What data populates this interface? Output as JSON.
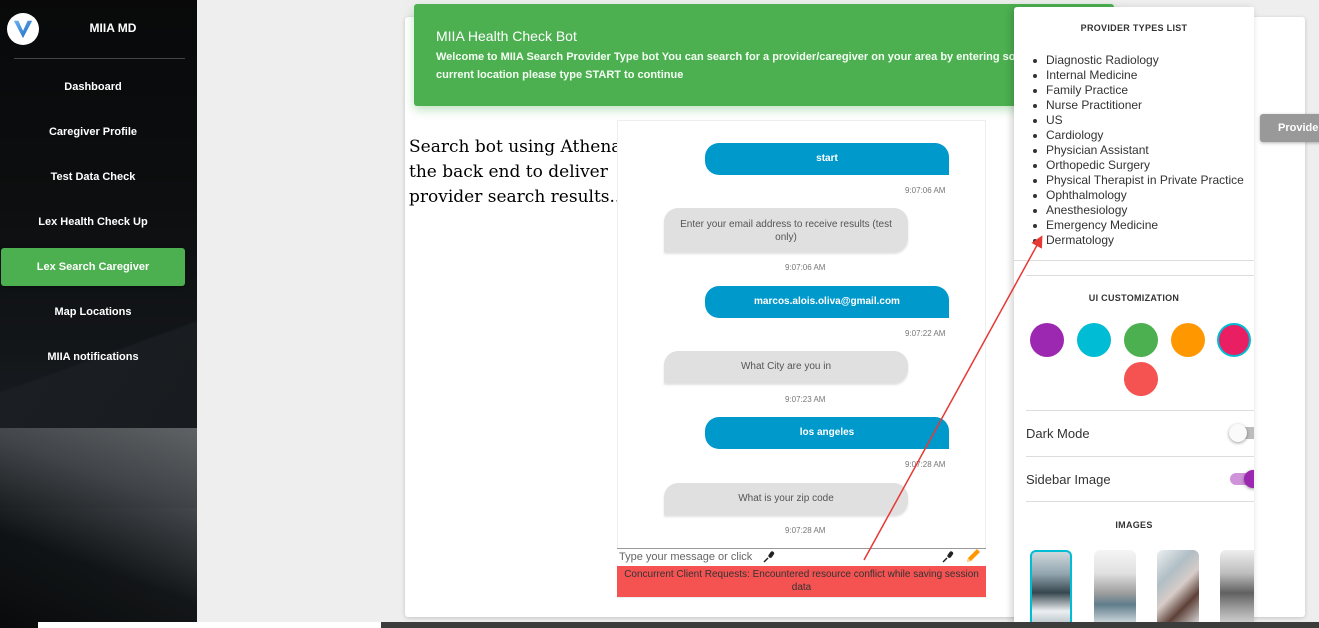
{
  "sidebar": {
    "brand": "MIIA MD",
    "items": [
      {
        "label": "Dashboard"
      },
      {
        "label": "Caregiver Profile"
      },
      {
        "label": "Test Data Check"
      },
      {
        "label": "Lex Health Check Up"
      },
      {
        "label": "Lex Search Caregiver",
        "active": true
      },
      {
        "label": "Map Locations"
      },
      {
        "label": "MIIA notifications"
      }
    ]
  },
  "header": {
    "title": "MIIA Health Check Bot",
    "line1": "Welcome to MIIA Search Provider Type bot You can search for a provider/caregiver on your area by entering some",
    "line2": "current location please type START to continue"
  },
  "annotation": {
    "text": "Search bot using Athena on the back end to deliver provider search results..."
  },
  "chat": {
    "messages": [
      {
        "from": "user",
        "text": "start",
        "time": "9:07:06 AM"
      },
      {
        "from": "bot",
        "text": "Enter your email address to receive results (test only)",
        "time": "9:07:06 AM"
      },
      {
        "from": "user",
        "text": "marcos.alois.oliva@gmail.com",
        "time": "9:07:22 AM"
      },
      {
        "from": "bot",
        "text": "What City are you in",
        "time": "9:07:23 AM"
      },
      {
        "from": "user",
        "text": "los angeles",
        "time": "9:07:28 AM"
      },
      {
        "from": "bot",
        "text": "What is your zip code",
        "time": "9:07:28 AM"
      }
    ],
    "input_placeholder": "Type your message or click",
    "error": "Concurrent Client Requests: Encountered resource conflict while saving session data"
  },
  "panel": {
    "provider_types_title": "PROVIDER TYPES LIST",
    "provider_types": [
      "Diagnostic Radiology",
      "Internal Medicine",
      "Family Practice",
      "Nurse Practitioner",
      "US",
      "Cardiology",
      "Physician Assistant",
      "Orthopedic Surgery",
      "Physical Therapist in Private Practice",
      "Ophthalmology",
      "Anesthesiology",
      "Emergency Medicine",
      "Dermatology"
    ],
    "ui_customization_title": "UI CUSTOMIZATION",
    "colors": [
      "#9c27b0",
      "#00bcd4",
      "#4caf50",
      "#ff9800",
      "#e91e63",
      "#f55252"
    ],
    "selected_color": "#e91e63",
    "dark_mode_label": "Dark Mode",
    "dark_mode": false,
    "sidebar_image_label": "Sidebar Image",
    "sidebar_image": true,
    "images_title": "IMAGES"
  },
  "provider_button": {
    "label": "Provider"
  },
  "colors": {
    "primary": "#4caf50",
    "user_bubble": "#0099cc",
    "bot_bubble": "#e0e0e0",
    "error": "#f55252",
    "toggle_on": "#9c27b0"
  }
}
